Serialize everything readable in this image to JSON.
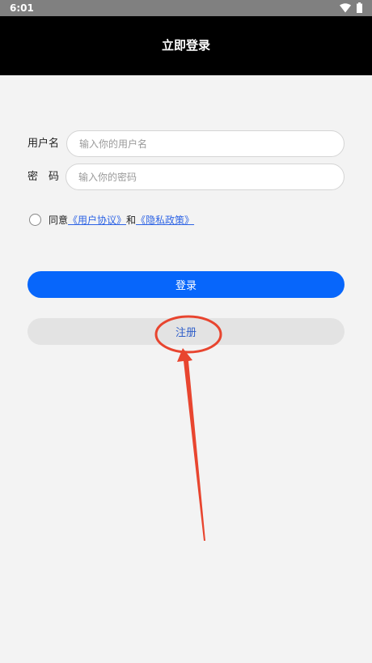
{
  "status_bar": {
    "time": "6:01"
  },
  "header": {
    "title": "立即登录"
  },
  "form": {
    "username_label": "用户名",
    "username_placeholder": "输入你的用户名",
    "password_label": "密　码",
    "password_placeholder": "输入你的密码"
  },
  "agreement": {
    "prefix": "同意",
    "user_agreement": "《用户协议》",
    "conjunction": "和",
    "privacy_policy": "《隐私政策》"
  },
  "buttons": {
    "login": "登录",
    "register": "注册"
  },
  "colors": {
    "primary": "#0766fb",
    "link": "#2e64e5",
    "annotation": "#e8452f"
  }
}
